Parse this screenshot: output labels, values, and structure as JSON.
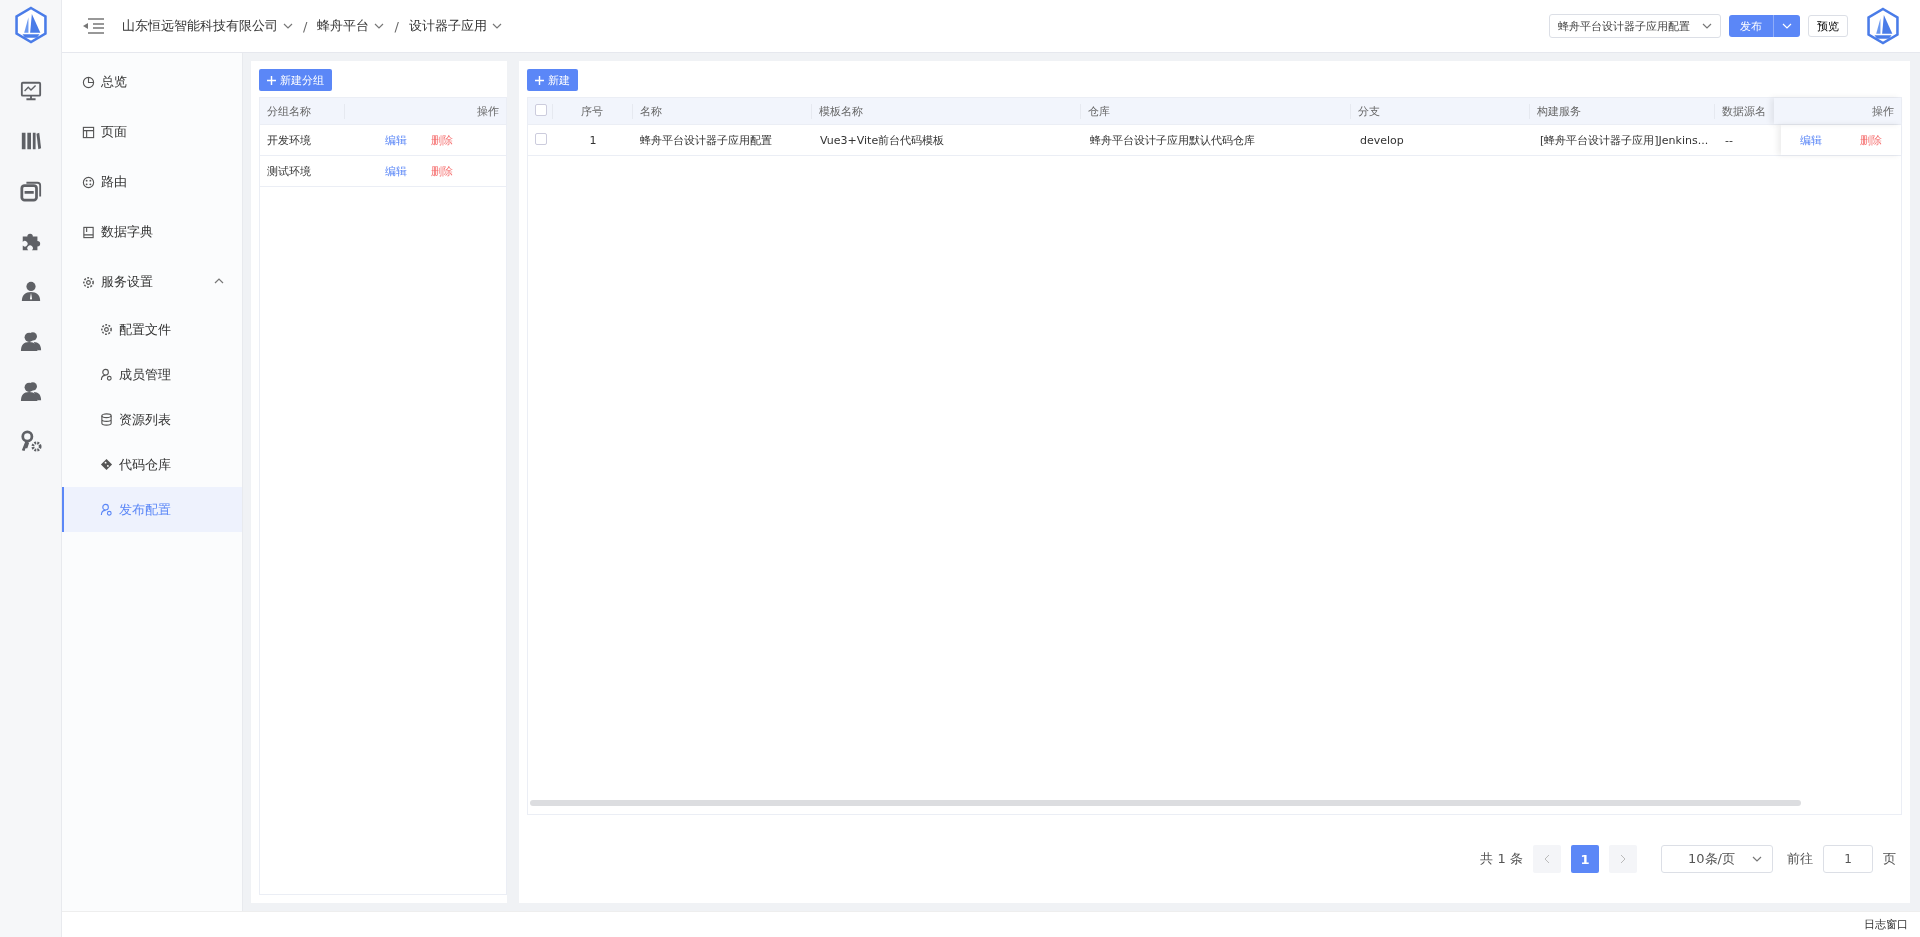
{
  "breadcrumb": [
    {
      "label": "山东恒远智能科技有限公司"
    },
    {
      "separator": "/",
      "label": "蜂舟平台"
    },
    {
      "separator": "/",
      "label": "设计器子应用"
    }
  ],
  "header": {
    "config_select": "蜂舟平台设计器子应用配置",
    "publish_button": "发布",
    "preview_button": "预览"
  },
  "menu": [
    {
      "kind": "item",
      "label": "总览",
      "selected": false
    },
    {
      "kind": "item",
      "label": "页面",
      "selected": false
    },
    {
      "kind": "item",
      "label": "路由",
      "selected": false
    },
    {
      "kind": "item",
      "label": "数据字典",
      "selected": false
    },
    {
      "kind": "group",
      "label": "服务设置",
      "expanded": true,
      "selected": false,
      "children": [
        {
          "label": "配置文件",
          "selected": false
        },
        {
          "label": "成员管理",
          "selected": false
        },
        {
          "label": "资源列表",
          "selected": false
        },
        {
          "label": "代码仓库",
          "selected": false
        },
        {
          "label": "发布配置",
          "selected": true
        }
      ]
    }
  ],
  "groups": {
    "new_button": "新建分组",
    "columns": [
      "分组名称",
      "操作"
    ],
    "rows": [
      {
        "name": "开发环境",
        "edit": "编辑",
        "delete": "删除"
      },
      {
        "name": "测试环境",
        "edit": "编辑",
        "delete": "删除"
      }
    ]
  },
  "table": {
    "new_button": "新建",
    "all_checked": false,
    "columns": [
      "序号",
      "名称",
      "模板名称",
      "仓库",
      "分支",
      "构建服务",
      "数据源名",
      "操作"
    ],
    "rows": [
      {
        "checked": false,
        "cells": [
          "1",
          "蜂舟平台设计器子应用配置",
          "Vue3+Vite前台代码模板",
          "蜂舟平台设计子应用默认代码仓库",
          "develop",
          "[蜂舟平台设计器子应用]Jenkins...",
          "--"
        ],
        "edit": "编辑",
        "delete": "删除"
      }
    ]
  },
  "pagination": {
    "total": "共 1 条",
    "pages": [
      {
        "label": "1",
        "selected": true
      }
    ],
    "page_size": "10条/页",
    "goto_label": "前往",
    "goto_value": "1",
    "page_suffix": "页"
  },
  "footer": {
    "log_window": "日志窗口"
  }
}
